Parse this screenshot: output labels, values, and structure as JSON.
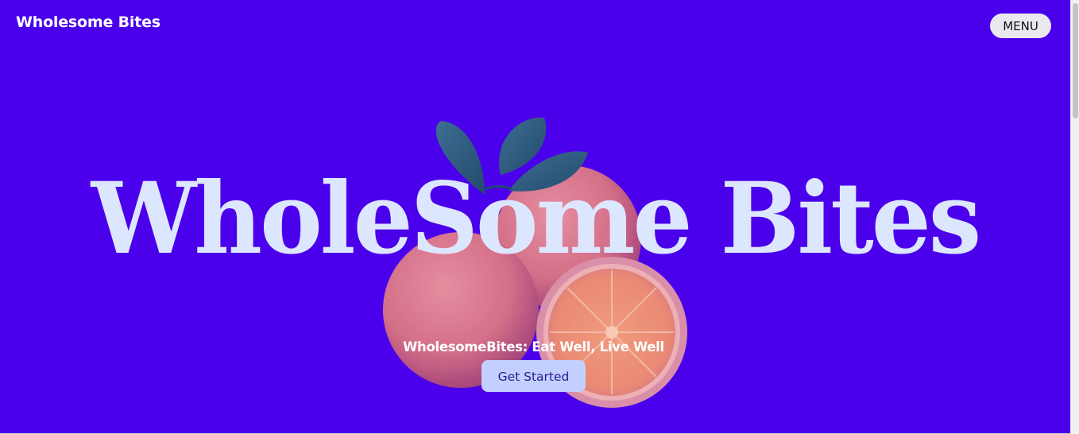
{
  "header": {
    "brand": "Wholesome Bites",
    "menu_label": "MENU"
  },
  "hero": {
    "title": "WholeSome Bites",
    "tagline": "WholesomeBites: Eat Well, Live Well",
    "cta_label": "Get Started",
    "image_subject": "oranges-with-leaves"
  },
  "colors": {
    "background": "#4b00ec",
    "title": "#dde6ff",
    "cta_background": "#c3d0ff",
    "cta_text": "#2a1a8f",
    "menu_background": "#ebe9f0"
  }
}
